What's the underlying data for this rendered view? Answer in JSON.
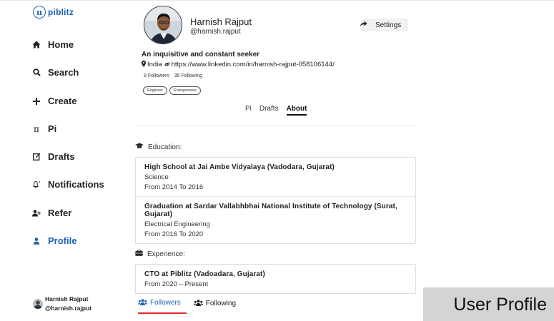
{
  "brand": {
    "mark": "π",
    "name": "piblitz"
  },
  "sidebar": {
    "items": [
      {
        "label": "Home",
        "icon": "home-icon"
      },
      {
        "label": "Search",
        "icon": "search-icon"
      },
      {
        "label": "Create",
        "icon": "plus-icon"
      },
      {
        "label": "Pi",
        "icon": "pi-icon"
      },
      {
        "label": "Drafts",
        "icon": "edit-icon"
      },
      {
        "label": "Notifications",
        "icon": "bell-icon"
      },
      {
        "label": "Refer",
        "icon": "user-plus-icon"
      },
      {
        "label": "Profile",
        "icon": "user-icon",
        "active": true
      }
    ],
    "user": {
      "name": "Harnish Rajput",
      "handle": "@harnish.rajput"
    }
  },
  "profile": {
    "name": "Harnish Rajput",
    "handle": "@harnish.rajput",
    "settings_label": "Settings",
    "bio": "An inquisitive and constant seeker",
    "location": "India",
    "link": "https://www.linkedin.com/in/harnish-rajput-058106144/",
    "followers": "9 Followers",
    "following": "35 Following",
    "tags": [
      "Engineer",
      "Entrepreneur"
    ]
  },
  "tabs": [
    "Pi",
    "Drafts",
    "About"
  ],
  "active_tab": "About",
  "about": {
    "education_label": "Education:",
    "education": [
      {
        "title": "High School at Jai Ambe Vidyalaya (Vadodara, Gujarat)",
        "field": "Science",
        "period": "From 2014 To 2016"
      },
      {
        "title": "Graduation at Sardar Vallabhbhai National Institute of Technology (Surat, Gujarat)",
        "field": "Electrical Engineering",
        "period": "From 2016 To 2020"
      }
    ],
    "experience_label": "Experience:",
    "experience": [
      {
        "title": "CTO at Piblitz (Vadoadara, Gujarat)",
        "period": "From 2020 – Present"
      }
    ]
  },
  "follow_tabs": {
    "followers": "Followers",
    "following": "Following"
  },
  "overlay_label": "User Profile",
  "colors": {
    "accent": "#1f63b4",
    "active_underline": "#e02a2a"
  }
}
